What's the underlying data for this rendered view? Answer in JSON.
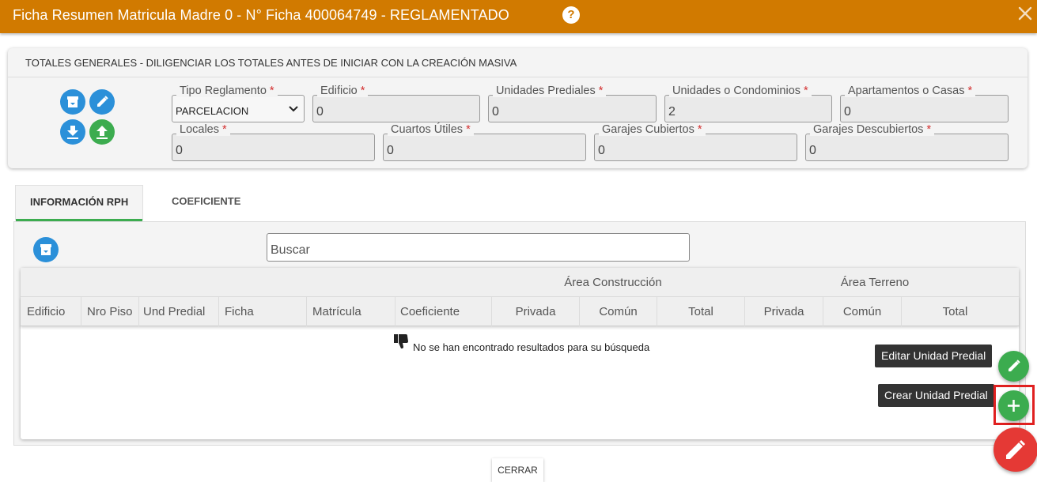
{
  "window": {
    "title": "Ficha Resumen Matricula Madre 0 - N° Ficha 400064749 - REGLAMENTADO",
    "help_glyph": "?",
    "close_icon": "close-icon"
  },
  "totals": {
    "heading": "TOTALES GENERALES - DILIGENCIAR LOS TOTALES ANTES DE INICIAR CON LA CREACIÓN MASIVA",
    "required_mark": "*",
    "fields": {
      "tipo_reglamento": {
        "label": "Tipo Reglamento",
        "value": "PARCELACION"
      },
      "edificio": {
        "label": "Edificio",
        "value": "0"
      },
      "unidades_prediales": {
        "label": "Unidades Prediales",
        "value": "0"
      },
      "unidades_condominios": {
        "label": "Unidades o Condominios",
        "value": "2"
      },
      "apartamentos_casas": {
        "label": "Apartamentos o Casas",
        "value": "0"
      },
      "locales": {
        "label": "Locales",
        "value": "0"
      },
      "cuartos_utiles": {
        "label": "Cuartos Útiles",
        "value": "0"
      },
      "garajes_cubiertos": {
        "label": "Garajes Cubiertos",
        "value": "0"
      },
      "garajes_descubiertos": {
        "label": "Garajes Descubiertos",
        "value": "0"
      }
    }
  },
  "tabs": [
    {
      "label": "INFORMACIÓN RPH",
      "active": true
    },
    {
      "label": "COEFICIENTE",
      "active": false
    }
  ],
  "search": {
    "placeholder": "Buscar"
  },
  "table": {
    "groups": [
      "Área Construcción",
      "Área Terreno"
    ],
    "columns": [
      "Edificio",
      "Nro Piso",
      "Und Predial",
      "Ficha",
      "Matrícula",
      "Coeficiente",
      "Privada",
      "Común",
      "Total",
      "Privada",
      "Común",
      "Total"
    ],
    "empty_message": "No se han encontrado resultados para su búsqueda"
  },
  "actions": {
    "edit_tooltip": "Editar Unidad Predial",
    "create_tooltip": "Crear Unidad Predial"
  },
  "footer": {
    "close_label": "CERRAR"
  },
  "colors": {
    "header": "#d17a00",
    "accent_green": "#3cac4f",
    "accent_blue": "#2b90d9",
    "fab_red": "#e53935"
  }
}
